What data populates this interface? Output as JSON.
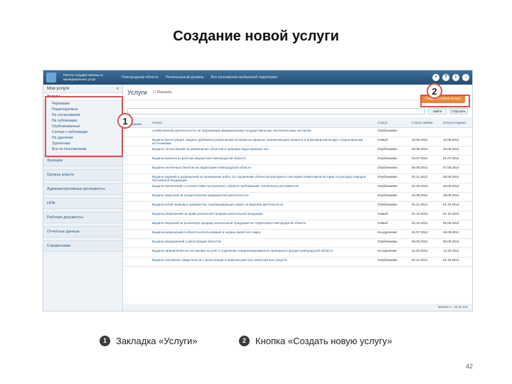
{
  "slide": {
    "title": "Создание новой услуги",
    "page_number": "42"
  },
  "app": {
    "header_logo_text": "Реестр государственных и муниципальных услуг",
    "header_nav": [
      "Новгородская область",
      "Региональный уровень",
      "Все полномочия выбранной территории"
    ],
    "services_title": "Услуги",
    "show_label": "Показать",
    "create_button_label": "Создать новую услугу",
    "search_button": "Найти",
    "reset_button": "Сбросить",
    "sidebar_header": "Мои услуги",
    "sidebar_active": "Услуги",
    "sidebar_subitems": [
      "Черновики",
      "Редактируемые",
      "На согласовании",
      "На публикацию",
      "Опубликованные",
      "Снятые с публикации",
      "На удаление",
      "Удаленные",
      "Все по полномочиям"
    ],
    "sidebar_sections": [
      "Функции",
      "Органы власти",
      "Административные регламенты",
      "НПА",
      "Рабочие документы",
      "Отчетные данные",
      "Справочники"
    ],
    "columns": [
      "Нов. сообщение",
      "Услуга",
      "Статус",
      "Статус заявки",
      "Услуга создана"
    ],
    "rows": [
      {
        "name": "хозяйственной деятельности, не подлежащих федеральному государственному экологическому контролю",
        "status": "Опубликован",
        "req": "",
        "date": ""
      },
      {
        "name": "Выдача (регистрация, выдача дубликата) разрешений на выбросы вредных (загрязняющих) веществ в атмосферный воздух стационарными источниками",
        "status": "Новый",
        "req": "10.06.2014",
        "date": "10.06.2014"
      },
      {
        "name": "Выдача согласований на размещение объектов в границах водоохранных зон",
        "status": "Опубликован",
        "req": "25.06.2014",
        "date": "25.06.2014"
      },
      {
        "name": "Выдача выписок из реестра имущества Новгородской области",
        "status": "Опубликован",
        "req": "04.07.2014",
        "date": "01.07.2014"
      },
      {
        "name": "Выдача охотничьих билетов на территории Новгородской области",
        "status": "Опубликован",
        "req": "05.08.2012",
        "date": "07.08.2014"
      },
      {
        "name": "Выдача заданий и разрешений на проведение работ по сохранению объектов культурного наследия (памятников истории и культуры) народов Российской Федерации",
        "status": "Опубликован",
        "req": "01.11.2012",
        "date": "25.08.2014"
      },
      {
        "name": "Выдача заключений о соответствии построенного объекта требованиям технических регламентов",
        "status": "Опубликован",
        "req": "21.03.2013",
        "date": "25.08.2014"
      },
      {
        "name": "Выдача лицензий на осуществление медицинской деятельности",
        "status": "Опубликован",
        "req": "22.08.2012",
        "date": "29.08.2014"
      },
      {
        "name": "Выдача копий правовых документов, подтверждающих право на ведение деятельности",
        "status": "Опубликован",
        "req": "01.11.2012",
        "date": "01.10.2014"
      },
      {
        "name": "Выдача разрешений на право розничной продажи алкогольной продукции",
        "status": "Новый",
        "req": "01.10.2014",
        "date": "01.10.2014"
      },
      {
        "name": "Выдача лицензий на розничную продажу алкогольной продукции на территории Новгородской области",
        "status": "Новый",
        "req": "01.12.2014",
        "date": "05.05.2014"
      },
      {
        "name": "Выдача разрешений в области использования и охраны животного мира",
        "status": "На удалении",
        "req": "01.07.2012",
        "date": "26.08.2014"
      },
      {
        "name": "Выдача уведомлений о регистрации объектов",
        "status": "Опубликован",
        "req": "06.06.2012",
        "date": "05.09.2014"
      },
      {
        "name": "Выдача направления на постановку на учет в отделение специализированного жилищного фонда Новгородской области",
        "status": "На удалении",
        "req": "21.04.2012",
        "date": "13.10.2014"
      },
      {
        "name": "Выдача платежных свидетельств о регистрации и ведении реестра транспортных средств",
        "status": "Опубликован",
        "req": "01.11.2012",
        "date": "01.10.2014"
      }
    ],
    "footer": "Записи 1 - 20 из 212"
  },
  "callouts": {
    "one": "1",
    "two": "2"
  },
  "legend": {
    "item1_num": "1",
    "item1_text": "Закладка «Услуги»",
    "item2_num": "2",
    "item2_text": "Кнопка «Создать новую услугу»"
  },
  "colors": {
    "accent_orange": "#e8873a",
    "callout_red": "#d9534f",
    "header_blue": "#244e74"
  }
}
